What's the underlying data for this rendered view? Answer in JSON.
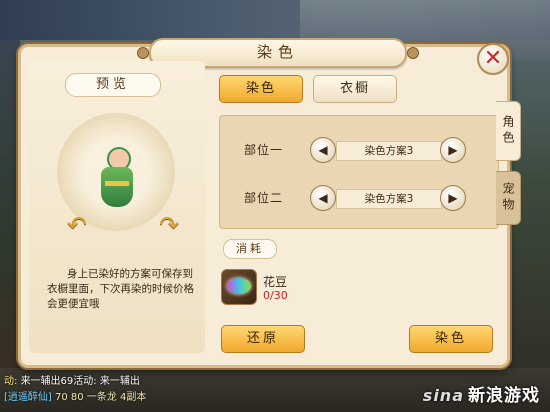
{
  "dialog": {
    "title": "染色",
    "preview_label": "预览",
    "description": "身上已染好的方案可保存到衣橱里面，下次再染的时候价格会更便宜哦",
    "tabs": {
      "dye": "染色",
      "wardrobe": "衣橱"
    },
    "side_tabs": {
      "role": "角色",
      "pet": "宠物"
    },
    "slots": [
      {
        "label": "部位一",
        "scheme": "染色方案3"
      },
      {
        "label": "部位二",
        "scheme": "染色方案3"
      }
    ],
    "consume_label": "消耗",
    "item": {
      "name": "花豆",
      "count": "0/30"
    },
    "buttons": {
      "restore": "还原",
      "dye": "染色"
    },
    "close_glyph": "✕"
  },
  "chat": {
    "line1_prefix": "动:",
    "line1_text": "来一辅出69活动: 来一辅出",
    "line2_guild": "[逍遥醉仙]",
    "line2_text": "70  80  一条龙  4副本"
  },
  "watermark": {
    "brand": "sina",
    "text": "新浪游戏"
  },
  "icons": {
    "rotate_left": "rotate-left-icon",
    "rotate_right": "rotate-right-icon",
    "arrow_left": "triangle-left-icon",
    "arrow_right": "triangle-right-icon"
  },
  "colors": {
    "accent": "#f0a92b",
    "close": "#d4252b",
    "count": "#d42020"
  }
}
